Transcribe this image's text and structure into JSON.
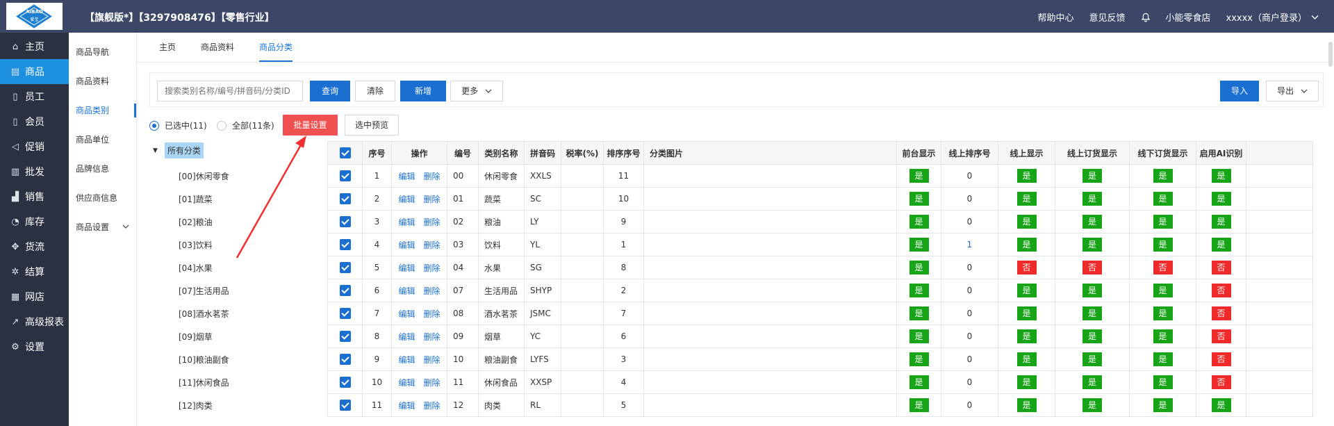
{
  "header": {
    "logo_text_top": "AIBAO",
    "logo_text_bottom": "爱宝",
    "org_info": "【旗舰版*】【3297908476】【零售行业】",
    "nav": {
      "help": "帮助中心",
      "feedback": "意见反馈",
      "store": "小能零食店",
      "user": "xxxxx（商户登录）"
    }
  },
  "sidebar": {
    "items": [
      {
        "label": "主页",
        "icon": "home-icon"
      },
      {
        "label": "商品",
        "icon": "goods-icon",
        "active": true
      },
      {
        "label": "员工",
        "icon": "staff-icon"
      },
      {
        "label": "会员",
        "icon": "member-icon"
      },
      {
        "label": "促销",
        "icon": "promo-icon"
      },
      {
        "label": "批发",
        "icon": "wholesale-icon"
      },
      {
        "label": "销售",
        "icon": "sales-icon"
      },
      {
        "label": "库存",
        "icon": "inventory-icon"
      },
      {
        "label": "货流",
        "icon": "flow-icon"
      },
      {
        "label": "结算",
        "icon": "settle-icon"
      },
      {
        "label": "网店",
        "icon": "shop-icon"
      },
      {
        "label": "高级报表",
        "icon": "report-icon"
      },
      {
        "label": "设置",
        "icon": "settings-icon"
      }
    ]
  },
  "subnav": {
    "items": [
      {
        "label": "商品导航"
      },
      {
        "label": "商品资料"
      },
      {
        "label": "商品类别",
        "active": true
      },
      {
        "label": "商品单位"
      },
      {
        "label": "品牌信息"
      },
      {
        "label": "供应商信息"
      },
      {
        "label": "商品设置",
        "has_children": true
      }
    ]
  },
  "tabs": [
    {
      "label": "主页"
    },
    {
      "label": "商品资料"
    },
    {
      "label": "商品分类",
      "active": true
    }
  ],
  "toolbar": {
    "search_placeholder": "搜索类别名称/编号/拼音码/分类ID",
    "query": "查询",
    "clear": "清除",
    "add": "新增",
    "more": "更多",
    "import": "导入",
    "export": "导出"
  },
  "filter": {
    "selected": "已选中(11)",
    "all": "全部(11条)",
    "batch": "批量设置",
    "preview": "选中预览"
  },
  "tree": {
    "root": "所有分类",
    "nodes": [
      "[00]休闲零食",
      "[01]蔬菜",
      "[02]粮油",
      "[03]饮料",
      "[04]水果",
      "[07]生活用品",
      "[08]酒水茗茶",
      "[09]烟草",
      "[10]粮油副食",
      "[11]休闲食品",
      "[12]肉类"
    ]
  },
  "table": {
    "headers": [
      "序号",
      "操作",
      "编号",
      "类别名称",
      "拼音码",
      "税率(%)",
      "排序序号",
      "分类图片",
      "前台显示",
      "线上排序号",
      "线上显示",
      "线上订货显示",
      "线下订货显示",
      "启用AI识别"
    ],
    "edit_label": "编辑",
    "delete_label": "删除",
    "yes": "是",
    "no": "否",
    "rows": [
      {
        "seq": "1",
        "code": "00",
        "name": "休闲零食",
        "pinyin": "XXLS",
        "tax": "",
        "sort": "11",
        "front": "是",
        "online_sort": "0",
        "online": "是",
        "online_order": "是",
        "offline_order": "是",
        "ai": "是"
      },
      {
        "seq": "2",
        "code": "01",
        "name": "蔬菜",
        "pinyin": "SC",
        "tax": "",
        "sort": "10",
        "front": "是",
        "online_sort": "0",
        "online": "是",
        "online_order": "是",
        "offline_order": "是",
        "ai": "是"
      },
      {
        "seq": "3",
        "code": "02",
        "name": "粮油",
        "pinyin": "LY",
        "tax": "",
        "sort": "9",
        "front": "是",
        "online_sort": "0",
        "online": "是",
        "online_order": "是",
        "offline_order": "是",
        "ai": "是"
      },
      {
        "seq": "4",
        "code": "03",
        "name": "饮料",
        "pinyin": "YL",
        "tax": "",
        "sort": "1",
        "front": "是",
        "online_sort": "1",
        "online": "是",
        "online_order": "是",
        "offline_order": "是",
        "ai": "是"
      },
      {
        "seq": "5",
        "code": "04",
        "name": "水果",
        "pinyin": "SG",
        "tax": "",
        "sort": "8",
        "front": "是",
        "online_sort": "0",
        "online": "否",
        "online_order": "否",
        "offline_order": "否",
        "ai": "否"
      },
      {
        "seq": "6",
        "code": "07",
        "name": "生活用品",
        "pinyin": "SHYP",
        "tax": "",
        "sort": "2",
        "front": "是",
        "online_sort": "0",
        "online": "是",
        "online_order": "是",
        "offline_order": "是",
        "ai": "否"
      },
      {
        "seq": "7",
        "code": "08",
        "name": "酒水茗茶",
        "pinyin": "JSMC",
        "tax": "",
        "sort": "7",
        "front": "是",
        "online_sort": "0",
        "online": "是",
        "online_order": "是",
        "offline_order": "是",
        "ai": "否"
      },
      {
        "seq": "8",
        "code": "09",
        "name": "烟草",
        "pinyin": "YC",
        "tax": "",
        "sort": "6",
        "front": "是",
        "online_sort": "0",
        "online": "是",
        "online_order": "是",
        "offline_order": "是",
        "ai": "否"
      },
      {
        "seq": "9",
        "code": "10",
        "name": "粮油副食",
        "pinyin": "LYFS",
        "tax": "",
        "sort": "3",
        "front": "是",
        "online_sort": "0",
        "online": "是",
        "online_order": "是",
        "offline_order": "是",
        "ai": "否"
      },
      {
        "seq": "10",
        "code": "11",
        "name": "休闲食品",
        "pinyin": "XXSP",
        "tax": "",
        "sort": "4",
        "front": "是",
        "online_sort": "0",
        "online": "是",
        "online_order": "是",
        "offline_order": "是",
        "ai": "否"
      },
      {
        "seq": "11",
        "code": "12",
        "name": "肉类",
        "pinyin": "RL",
        "tax": "",
        "sort": "5",
        "front": "是",
        "online_sort": "0",
        "online": "是",
        "online_order": "是",
        "offline_order": "是",
        "ai": "是"
      }
    ]
  },
  "colors": {
    "topbar": "#3c4666",
    "sidebar": "#2c3142",
    "accent": "#1a6fd1",
    "yes": "#17a417",
    "no": "#ef2a2a",
    "batch_button": "#ef5050",
    "annotation_arrow": "#ef3030"
  }
}
